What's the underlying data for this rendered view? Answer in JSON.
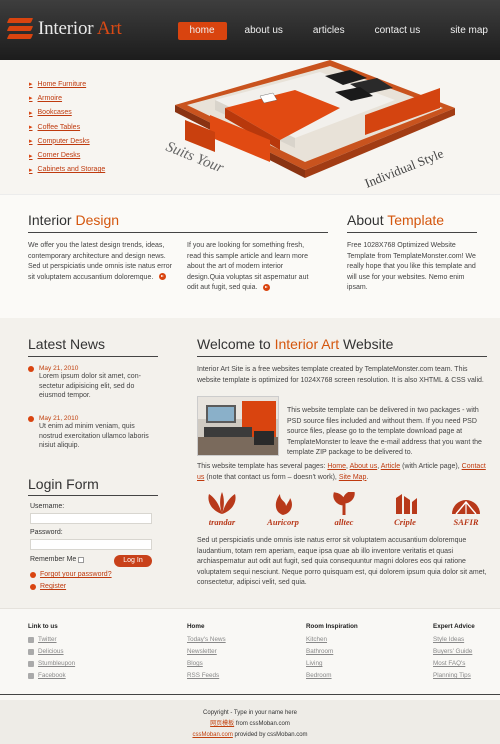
{
  "header": {
    "logo_word1": "Interior",
    "logo_word2": "Art",
    "nav": [
      "home",
      "about us",
      "articles",
      "contact us",
      "site map"
    ]
  },
  "hero": {
    "categories": [
      "Home Furniture",
      "Armoire",
      "Bookcases",
      "Coffee Tables",
      "Computer Desks",
      "Corner Desks",
      "Cabinets and Storage"
    ],
    "slogan_1": "Suits Your",
    "slogan_2": "Individual Style"
  },
  "info": {
    "interior_title_1": "Interior",
    "interior_title_2": "Design",
    "col1_text": "We offer you the latest design trends, ideas, contemporary architecture and design news. Sed ut perspiciatis unde omnis iste natus error sit voluptatem accusantium doloremque.",
    "col2_text": "If you are looking for something fresh, read this sample article and learn more about the art of modern interior design.Quia voluptas sit aspernatur aut odit aut fugit, sed quia.",
    "about_title_1": "About",
    "about_title_2": "Template",
    "col3_text": "Free 1028X768 Optimized Website Template from TemplateMonster.com! We really hope that you like this template and will use for your websites. Nemo enim ipsam."
  },
  "news": {
    "title": "Latest News",
    "items": [
      {
        "date": "May 21, 2010",
        "text": "Lorem ipsum dolor sit amet, con- sectetur adipisicing elit, sed do eiusmod tempor."
      },
      {
        "date": "May 21, 2010",
        "text": "Ut enim ad minim veniam, quis nostrud exercitation ullamco laboris nisiut aliquip."
      }
    ]
  },
  "login": {
    "title": "Login Form",
    "username_label": "Username:",
    "password_label": "Password:",
    "remember_label": "Remember Me",
    "button": "Log In",
    "forgot": "Forgot your password?",
    "register": "Register"
  },
  "welcome": {
    "title_1": "Welcome to",
    "title_2": "Interior Art",
    "title_3": "Website",
    "p1": "Interior Art Site is a free websites template created by TemplateMonster.com team. This website template is optimized for 1024X768 screen resolution. It is also XHTML & CSS valid.",
    "p2": "This website template can be delivered in two packages - with PSD source files included and without them. If you need PSD source files, please go to the template download page at TemplateMonster to leave the e-mail address that you want the template ZIP package to be delivered to.",
    "p3_start": "This website template has several pages: ",
    "p3_links": [
      "Home",
      "About us",
      "Article",
      "Contact us",
      "Site Map"
    ],
    "p3_mid1": ", ",
    "p3_mid2": " (with Article page), ",
    "p3_mid3": " (note that contact us form – doesn't work), ",
    "p3_end": ".",
    "brands": [
      "trandar",
      "Auricorp",
      "alltec",
      "Criple",
      "SAFIR"
    ],
    "p4": "Sed ut perspiciatis unde omnis iste natus error sit voluptatem accusantium doloremque laudantium, totam rem aperiam, eaque ipsa quae ab illo inventore veritatis et quasi archiaspernatur aut odit aut fugit, sed quia consequuntur magni dolores eos qui ratione voluptatem sequi nesciunt. Neque porro quisquam est, qui dolorem ipsum quia dolor sit amet, consectetur, adipisci velit, sed quia."
  },
  "footer": {
    "cols": [
      {
        "title": "Link to us",
        "items": [
          "Twitter",
          "Delicious",
          "Stumbleupon",
          "Facebook"
        ]
      },
      {
        "title": "Home",
        "items": [
          "Today's News",
          "Newsletter",
          "Blogs",
          "RSS Feeds"
        ]
      },
      {
        "title": "Room Inspiration",
        "items": [
          "Kitchen",
          "Bathroom",
          "Living",
          "Bedroom"
        ]
      },
      {
        "title": "Expert Advice",
        "items": [
          "Style Ideas",
          "Buyers' Guide",
          "Most FAQ's",
          "Planning Tips"
        ]
      }
    ],
    "copy_line1": "Copyright - Type in your name here",
    "copy_line2_link": "网页模板",
    "copy_line2_rest": " from cssMoban.com",
    "copy_line3_link": "cssMoban.com",
    "copy_line3_rest": " provided by cssMoban.com"
  },
  "colors": {
    "accent": "#d9440f",
    "header_bg": "#2a2a2a"
  }
}
